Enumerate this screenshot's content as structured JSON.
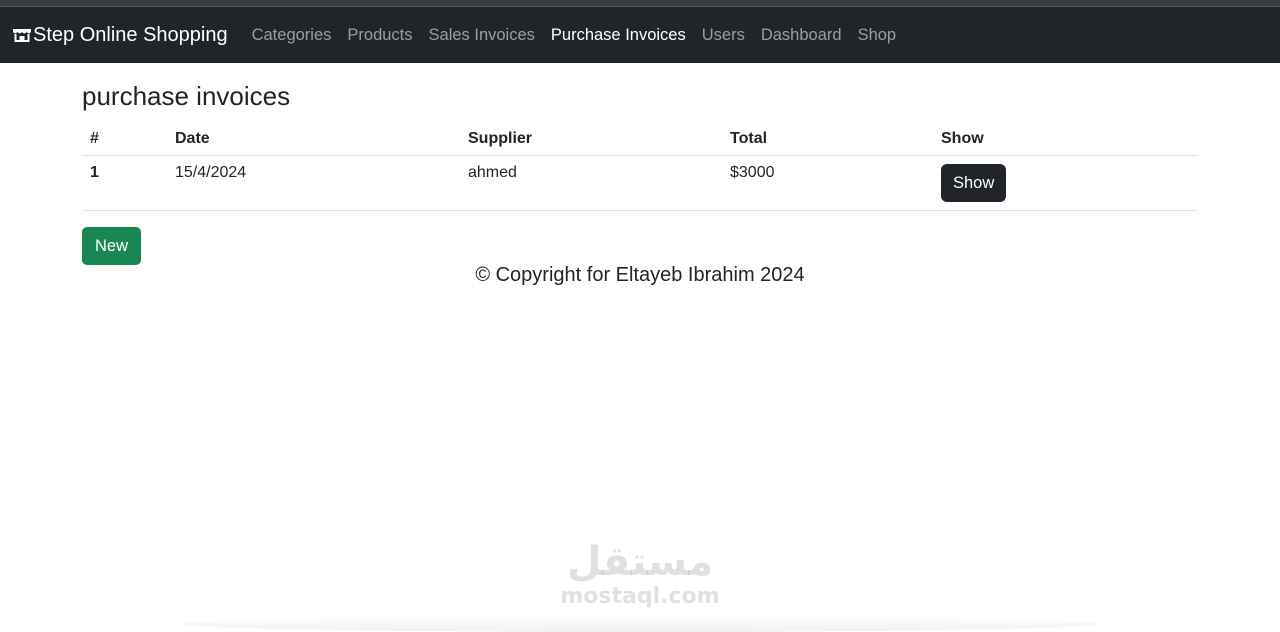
{
  "navbar": {
    "brand": "Step Online Shopping",
    "brand_icon": "shop-icon",
    "links": [
      {
        "label": "Categories",
        "active": false
      },
      {
        "label": "Products",
        "active": false
      },
      {
        "label": "Sales Invoices",
        "active": false
      },
      {
        "label": "Purchase Invoices",
        "active": true
      },
      {
        "label": "Users",
        "active": false
      },
      {
        "label": "Dashboard",
        "active": false
      },
      {
        "label": "Shop",
        "active": false
      }
    ]
  },
  "main": {
    "title": "purchase invoices",
    "table": {
      "headers": [
        "#",
        "Date",
        "Supplier",
        "Total",
        "Show"
      ],
      "rows": [
        {
          "num": "1",
          "date": "15/4/2024",
          "supplier": "ahmed",
          "total": "$3000",
          "action": "Show"
        }
      ]
    },
    "new_button": "New"
  },
  "footer": {
    "copyright": "© Copyright for Eltayeb Ibrahim 2024"
  },
  "watermark": {
    "arabic": "مستقل",
    "latin": "mostaql.com"
  },
  "colors": {
    "navbar_bg": "#212529",
    "show_button": "#212529",
    "new_button": "#198754"
  }
}
